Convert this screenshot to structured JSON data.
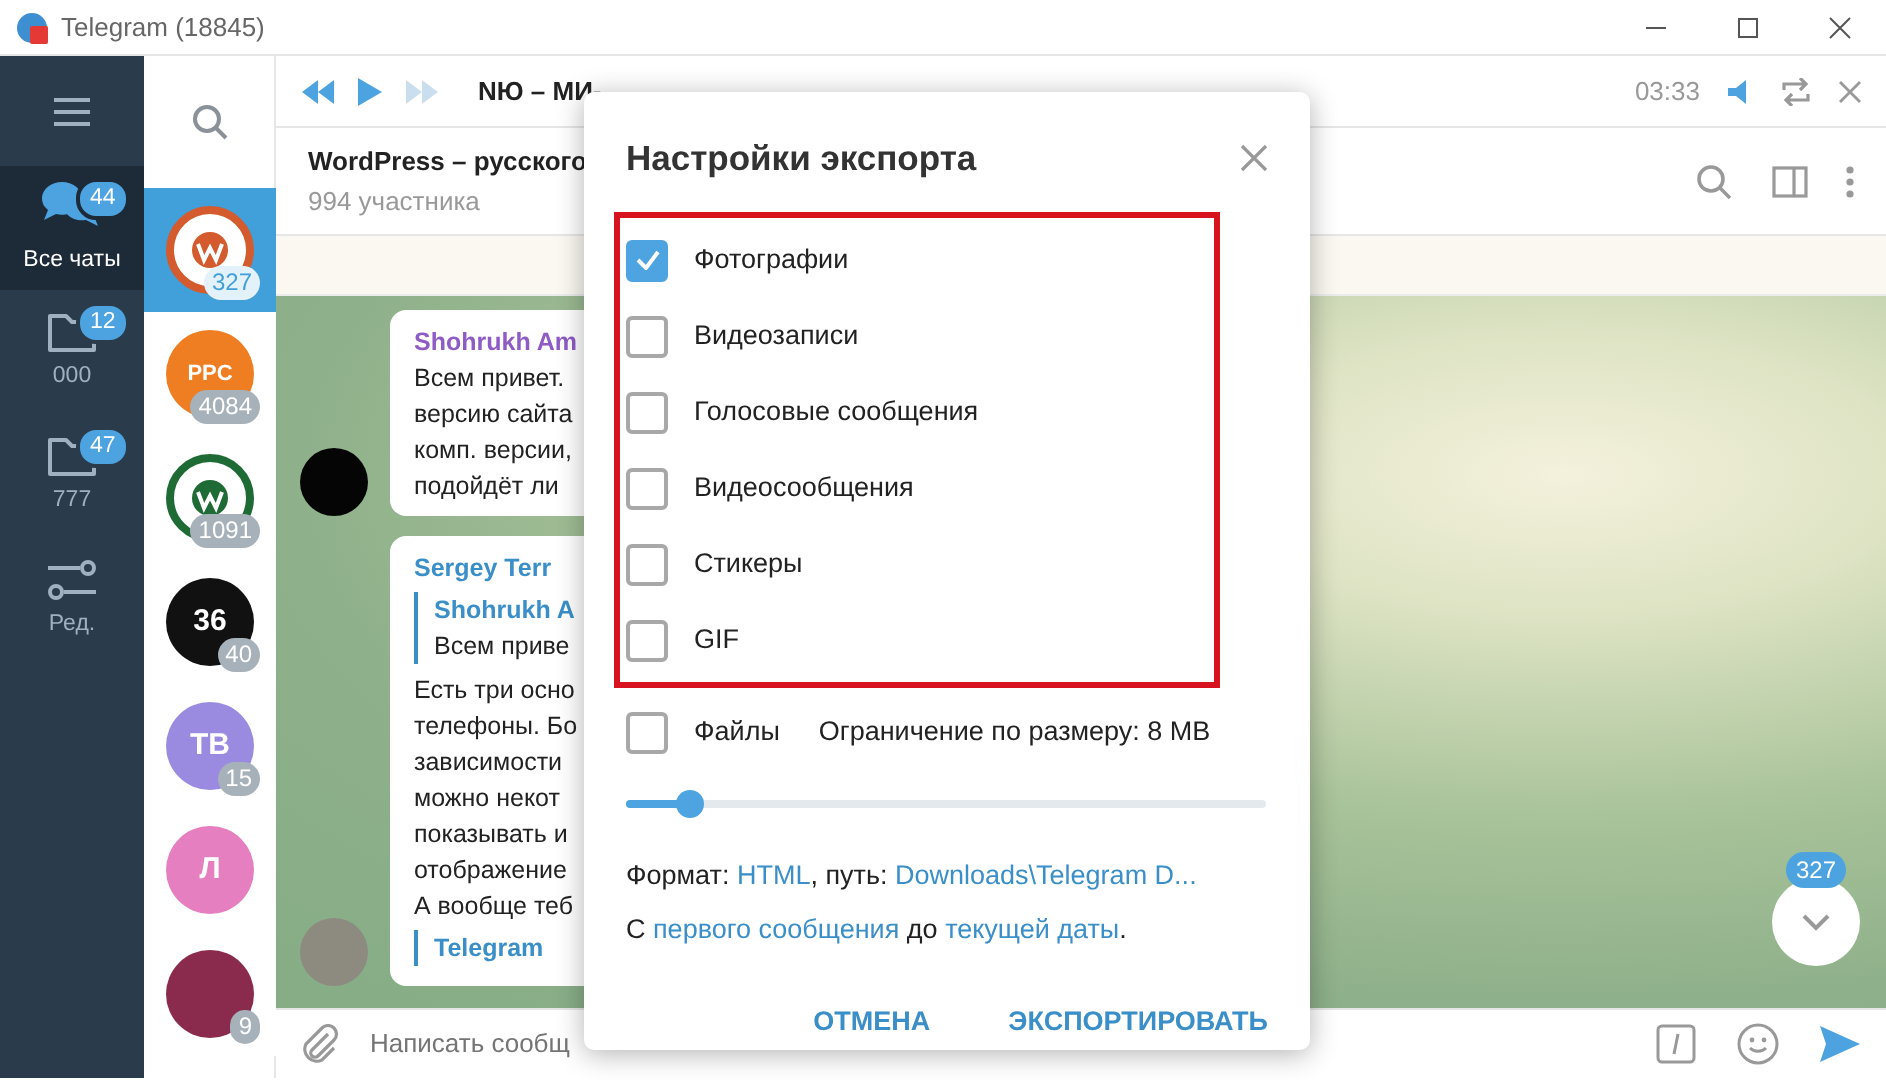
{
  "window": {
    "title": "Telegram (18845)"
  },
  "folders": [
    {
      "kind": "chats",
      "label": "Все чаты",
      "badge": "44",
      "selected": true
    },
    {
      "kind": "folder",
      "label": "000",
      "badge": "12",
      "selected": false
    },
    {
      "kind": "folder",
      "label": "777",
      "badge": "47",
      "selected": false
    },
    {
      "kind": "edit",
      "label": "Ред.",
      "selected": false
    }
  ],
  "chats": [
    {
      "kind": "logo",
      "color": "#d35b2d",
      "badge": "327",
      "selected": true
    },
    {
      "kind": "initials",
      "text": "PPC",
      "color": "#ef7d22",
      "badge": "4084",
      "selected": false
    },
    {
      "kind": "logo",
      "color": "#1f6b35",
      "badge": "1091",
      "selected": false
    },
    {
      "kind": "initials",
      "text": "36",
      "color": "#111111",
      "badge": "40",
      "selected": false
    },
    {
      "kind": "initials",
      "text": "TB",
      "color": "#9b8be0",
      "badge": "15",
      "selected": false
    },
    {
      "kind": "initials",
      "text": "Л",
      "color": "#e57fbf",
      "selected": false
    },
    {
      "kind": "photo",
      "color": "#8a2b4d",
      "badge": "9",
      "selected": false
    }
  ],
  "player": {
    "track": "NЮ – МИ-",
    "time": "03:33"
  },
  "chat_header": {
    "title": "WordPress – русского",
    "subtitle": "994 участника"
  },
  "messages": [
    {
      "author": "Shohrukh Am",
      "color": "#8e5cc4",
      "avatar": {
        "kind": "dark"
      },
      "lines": [
        "Всем привет.",
        "версию сайта",
        "комп. версии,",
        "подойдёт ли"
      ]
    },
    {
      "author": "Sergey Terr",
      "color": "#3a8fc9",
      "avatar": {
        "kind": "photo"
      },
      "reply": {
        "author": "Shohrukh A",
        "text": "Всем приве"
      },
      "lines": [
        "Есть три осно",
        "телефоны. Бо",
        "зависимости",
        "можно некот",
        "показывать и",
        "отображение",
        "А вообще теб"
      ],
      "preview": "Telegram"
    }
  ],
  "scroll_button": {
    "badge": "327"
  },
  "composer": {
    "placeholder": "Написать сообщ"
  },
  "dialog": {
    "title": "Настройки экспорта",
    "highlighted": true,
    "options": [
      {
        "label": "Фотографии",
        "checked": true
      },
      {
        "label": "Видеозаписи",
        "checked": false
      },
      {
        "label": "Голосовые сообщения",
        "checked": false
      },
      {
        "label": "Видеосообщения",
        "checked": false
      },
      {
        "label": "Стикеры",
        "checked": false
      },
      {
        "label": "GIF",
        "checked": false
      }
    ],
    "files": {
      "label": "Файлы",
      "checked": false,
      "limit": "Ограничение по размеру: 8 MB",
      "level": 0.1
    },
    "format_line": [
      {
        "text": "Формат: ",
        "link": false
      },
      {
        "text": "HTML",
        "link": true
      },
      {
        "text": ", путь: ",
        "link": false
      },
      {
        "text": "Downloads\\Telegram D...",
        "link": true
      }
    ],
    "range_line": [
      {
        "text": "С ",
        "link": false
      },
      {
        "text": "первого сообщения",
        "link": true
      },
      {
        "text": " до ",
        "link": false
      },
      {
        "text": "текущей даты",
        "link": true
      },
      {
        "text": ".",
        "link": false
      }
    ],
    "buttons": [
      "ОТМЕНА",
      "ЭКСПОРТИРОВАТЬ"
    ]
  }
}
